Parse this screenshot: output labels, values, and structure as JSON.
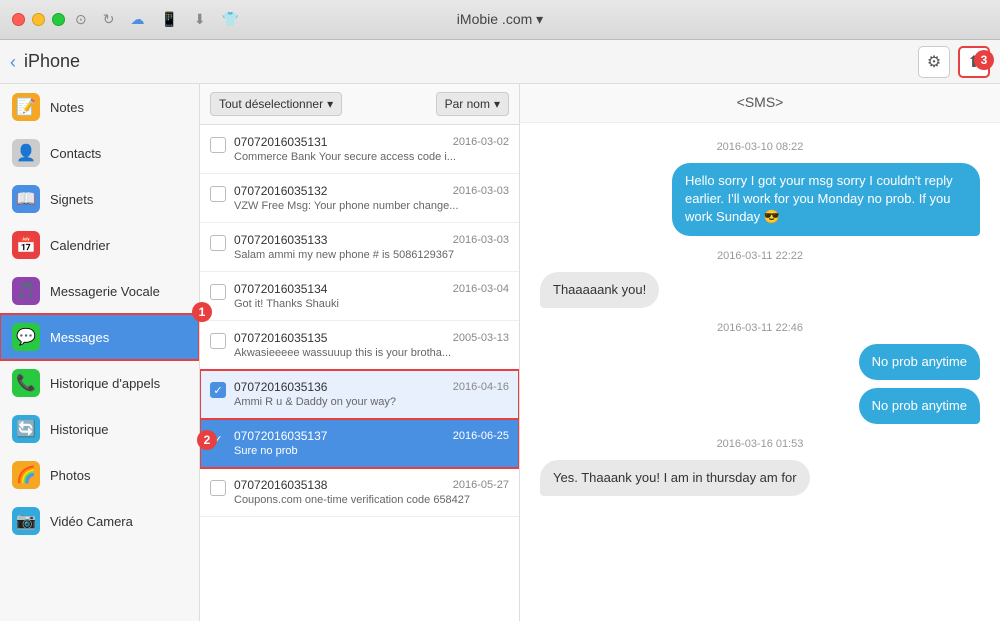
{
  "titlebar": {
    "app_name": "iMobie .com ▾"
  },
  "navbar": {
    "back_label": "‹",
    "device_name": "iPhone",
    "settings_icon": "⚙",
    "export_icon": "⬆"
  },
  "sidebar": {
    "items": [
      {
        "id": "notes",
        "label": "Notes",
        "icon_color": "#f5a623",
        "icon": "📝"
      },
      {
        "id": "contacts",
        "label": "Contacts",
        "icon_color": "#7b8d9e",
        "icon": "👤"
      },
      {
        "id": "signets",
        "label": "Signets",
        "icon_color": "#4a90e2",
        "icon": "📖"
      },
      {
        "id": "calendrier",
        "label": "Calendrier",
        "icon_color": "#e84040",
        "icon": "📅"
      },
      {
        "id": "messagerie",
        "label": "Messagerie Vocale",
        "icon_color": "#8e44ad",
        "icon": "🎵"
      },
      {
        "id": "messages",
        "label": "Messages",
        "icon_color": "#28c840",
        "icon": "💬"
      },
      {
        "id": "historique-appels",
        "label": "Historique d'appels",
        "icon_color": "#28c840",
        "icon": "📞"
      },
      {
        "id": "historique",
        "label": "Historique",
        "icon_color": "#34aadc",
        "icon": "🔄"
      },
      {
        "id": "photos",
        "label": "Photos",
        "icon_color": "#f5a623",
        "icon": "🌈"
      },
      {
        "id": "video",
        "label": "Vidéo Camera",
        "icon_color": "#34aadc",
        "icon": "📷"
      }
    ]
  },
  "list_panel": {
    "deselect_label": "Tout déselectionner",
    "sort_label": "Par nom",
    "items": [
      {
        "number": "07072016035131",
        "date": "2016-03-02",
        "preview": "Commerce Bank Your secure access code i...",
        "checked": false,
        "selected": false,
        "highlight": false
      },
      {
        "number": "07072016035132",
        "date": "2016-03-03",
        "preview": "VZW Free Msg: Your phone number change...",
        "checked": false,
        "selected": false,
        "highlight": false
      },
      {
        "number": "07072016035133",
        "date": "2016-03-03",
        "preview": "Salam ammi my new phone # is 5086129367",
        "checked": false,
        "selected": false,
        "highlight": false
      },
      {
        "number": "07072016035134",
        "date": "2016-03-04",
        "preview": "Got it! Thanks Shauki",
        "checked": false,
        "selected": false,
        "highlight": false
      },
      {
        "number": "07072016035135",
        "date": "2005-03-13",
        "preview": "Akwasieeeee wassuuup this is your brotha...",
        "checked": false,
        "selected": false,
        "highlight": false
      },
      {
        "number": "07072016035136",
        "date": "2016-04-16",
        "preview": "Ammi R u & Daddy on your way?",
        "checked": true,
        "selected": false,
        "highlight": true
      },
      {
        "number": "07072016035137",
        "date": "2016-06-25",
        "preview": "Sure no prob",
        "checked": true,
        "selected": true,
        "highlight": true
      },
      {
        "number": "07072016035138",
        "date": "2016-05-27",
        "preview": "Coupons.com one-time verification code 658427",
        "checked": false,
        "selected": false,
        "highlight": false
      }
    ]
  },
  "chat": {
    "title": "<SMS>",
    "messages": [
      {
        "type": "date",
        "text": "2016-03-10 08:22"
      },
      {
        "type": "outgoing",
        "text": "Hello sorry I got your msg sorry I couldn't reply earlier. I'll work for you Monday no prob. If you work Sunday 😎"
      },
      {
        "type": "date",
        "text": "2016-03-11 22:22"
      },
      {
        "type": "incoming",
        "text": "Thaaaaank you!"
      },
      {
        "type": "date",
        "text": "2016-03-11 22:46"
      },
      {
        "type": "outgoing",
        "text": "No prob anytime"
      },
      {
        "type": "outgoing",
        "text": "No prob anytime"
      },
      {
        "type": "date",
        "text": "2016-03-16 01:53"
      },
      {
        "type": "incoming",
        "text": "Yes.  Thaaank you! I am in thursday am for"
      }
    ]
  },
  "badges": {
    "b1": "1",
    "b2": "2",
    "b3": "3"
  }
}
